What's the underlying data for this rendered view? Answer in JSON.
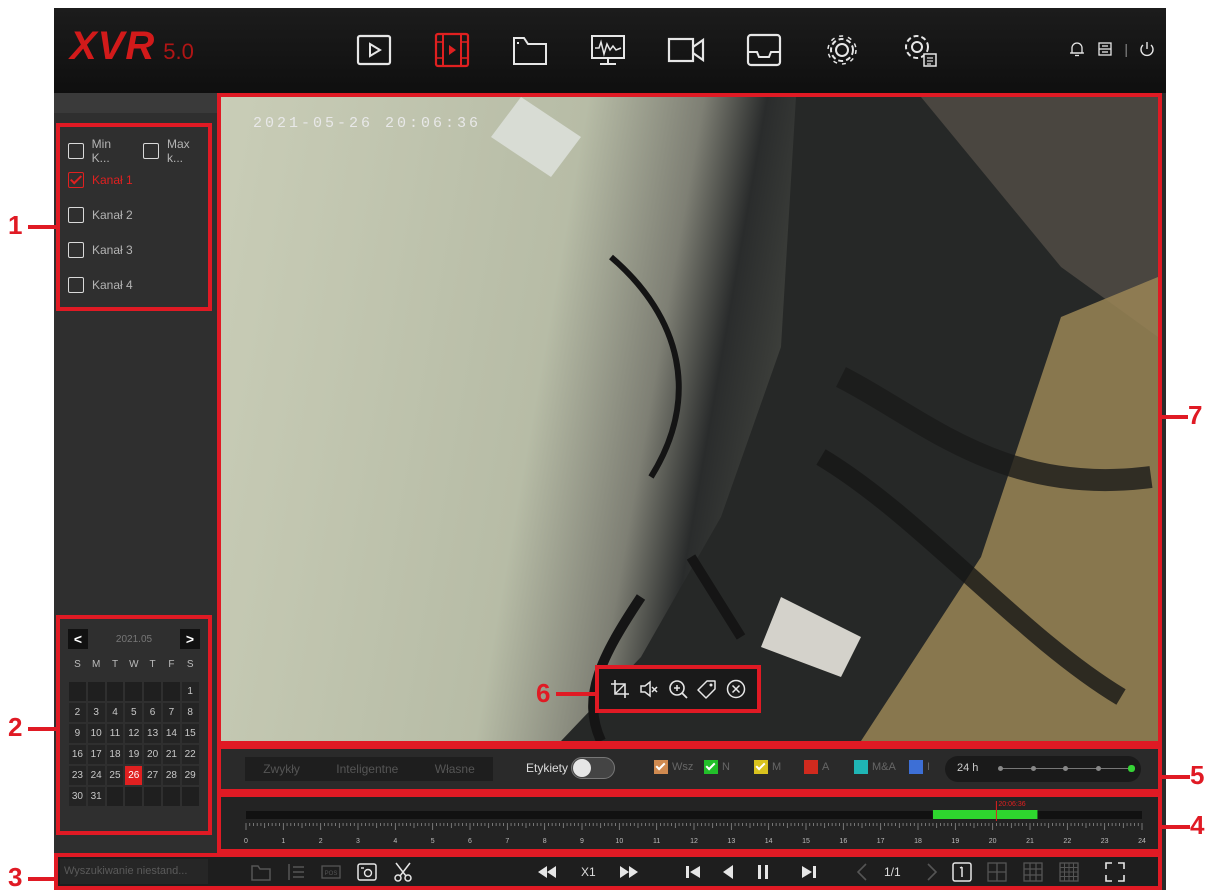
{
  "header": {
    "logo": "XVR",
    "version": "5.0",
    "nav": [
      {
        "name": "live-view",
        "icon": "play-icon"
      },
      {
        "name": "playback",
        "icon": "film-icon",
        "active": true
      },
      {
        "name": "file-management",
        "icon": "folder-icon"
      },
      {
        "name": "system-monitor",
        "icon": "monitor-icon"
      },
      {
        "name": "camera",
        "icon": "camera-icon"
      },
      {
        "name": "storage",
        "icon": "tray-icon"
      },
      {
        "name": "settings",
        "icon": "gear-icon"
      },
      {
        "name": "advanced-settings",
        "icon": "gear-list-icon"
      }
    ],
    "right_icons": [
      "bell-icon",
      "printer-icon",
      "power-icon"
    ],
    "separator": "|"
  },
  "channels": {
    "min_label": "Min K...",
    "max_label": "Max k...",
    "items": [
      {
        "label": "Kanał 1",
        "checked": true
      },
      {
        "label": "Kanał 2",
        "checked": false
      },
      {
        "label": "Kanał 3",
        "checked": false
      },
      {
        "label": "Kanał 4",
        "checked": false
      }
    ]
  },
  "calendar": {
    "title": "2021.05",
    "prev": "<",
    "next": ">",
    "dows": [
      "S",
      "M",
      "T",
      "W",
      "T",
      "F",
      "S"
    ],
    "leading_blanks": 6,
    "days": 31,
    "selected": 26
  },
  "video": {
    "osd_time": "2021-05-26  20:06:36",
    "tools": [
      "crop-icon",
      "mute-icon",
      "zoom-in-icon",
      "tag-icon",
      "close-icon"
    ]
  },
  "filter": {
    "tabs": [
      "Zwykły",
      "Inteligentne",
      "Własne"
    ],
    "tags_label": "Etykiety",
    "tags_on": false,
    "legend": [
      {
        "label": "Wsz",
        "color": "#d08a50",
        "checked": true
      },
      {
        "label": "N",
        "color": "#22c02a",
        "checked": true
      },
      {
        "label": "M",
        "color": "#d9c21e",
        "checked": true
      },
      {
        "label": "A",
        "color": "#d12a1e",
        "checked": false
      },
      {
        "label": "M&A",
        "color": "#1fb5b5",
        "checked": false
      },
      {
        "label": "I",
        "color": "#3d6fd6",
        "checked": false
      }
    ],
    "zoom_label": "24 h",
    "zoom_steps": 5,
    "zoom_selected": 5
  },
  "timeline": {
    "hours": [
      "0",
      "1",
      "2",
      "3",
      "4",
      "5",
      "6",
      "7",
      "8",
      "9",
      "10",
      "11",
      "12",
      "13",
      "14",
      "15",
      "16",
      "17",
      "18",
      "19",
      "20",
      "21",
      "22",
      "23",
      "24"
    ],
    "recording": {
      "start": 18.4,
      "end": 21.2,
      "color": "#2ed62e"
    },
    "cursor_label": "20:06:36",
    "cursor": 20.1
  },
  "bottom": {
    "search_placeholder": "Wyszukiwanie niestand...",
    "speed": "X1",
    "page": "1/1",
    "icons": [
      "folder-icon",
      "list-icon",
      "pos-icon",
      "snapshot-icon",
      "scissors-icon",
      "rewind-icon",
      "fast-forward-icon",
      "previous-frame-icon",
      "reverse-play-icon",
      "pause-icon",
      "next-frame-icon",
      "prev-page-icon",
      "next-page-icon",
      "single-view-icon",
      "quad-view-icon",
      "nine-view-icon",
      "sixteen-view-icon",
      "fullscreen-icon"
    ]
  },
  "callouts": [
    "1",
    "2",
    "3",
    "4",
    "5",
    "6",
    "7"
  ],
  "colors": {
    "accent": "#e01a24",
    "active_nav": "#e02020"
  }
}
